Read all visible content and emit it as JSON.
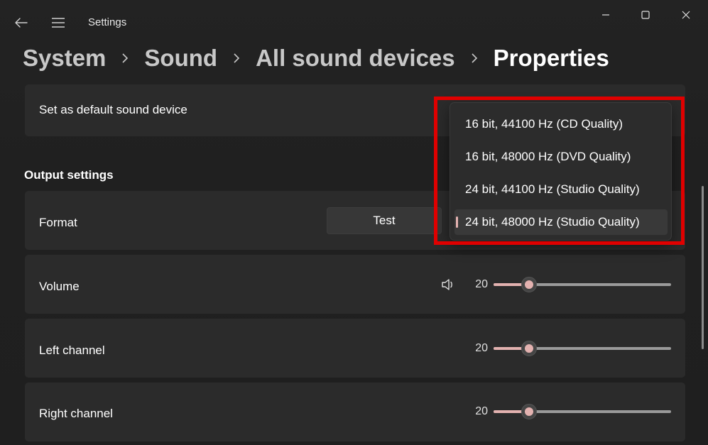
{
  "window": {
    "app_title": "Settings",
    "icons": {
      "back": "back-arrow-icon",
      "menu": "hamburger-menu-icon",
      "minimize": "minimize-icon",
      "maximize": "maximize-icon",
      "close": "close-icon",
      "speaker": "speaker-icon"
    }
  },
  "breadcrumb": {
    "items": [
      "System",
      "Sound",
      "All sound devices",
      "Properties"
    ],
    "separator_icon": "chevron-right-icon"
  },
  "default_device": {
    "label": "Set as default sound device"
  },
  "output_settings": {
    "title": "Output settings",
    "format": {
      "label": "Format",
      "test_button": "Test",
      "options": [
        "16 bit, 44100 Hz (CD Quality)",
        "16 bit, 48000 Hz (DVD Quality)",
        "24 bit, 44100 Hz (Studio Quality)",
        "24 bit, 48000 Hz (Studio Quality)"
      ],
      "selected_index": 3
    },
    "volume": {
      "label": "Volume",
      "value": "20",
      "level": 0.2
    },
    "left_channel": {
      "label": "Left channel",
      "value": "20",
      "level": 0.2
    },
    "right_channel": {
      "label": "Right channel",
      "value": "20",
      "level": 0.2
    }
  },
  "colors": {
    "accent": "#e3b2b0",
    "highlight_box": "#e00000",
    "card_background": "#2b2b2b",
    "window_background": "#202020"
  }
}
